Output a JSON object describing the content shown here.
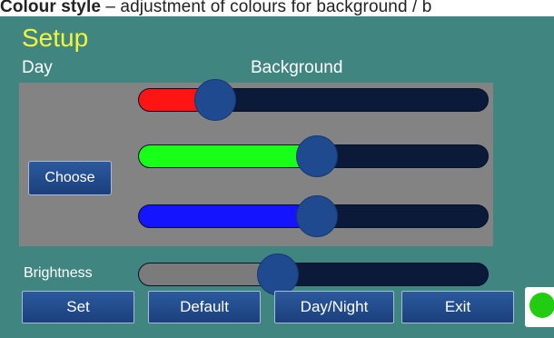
{
  "caption": {
    "bold": "Colour style",
    "rest": " – adjustment of colours for background / b"
  },
  "screen": {
    "title": "Setup",
    "mode_label": "Day",
    "section_label": "Background",
    "choose_label": "Choose",
    "brightness_label": "Brightness"
  },
  "sliders": [
    {
      "name": "red-slider",
      "color": "#ff1414",
      "value_pct": 22
    },
    {
      "name": "green-slider",
      "color": "#18ff18",
      "value_pct": 51
    },
    {
      "name": "blue-slider",
      "color": "#1414ff",
      "value_pct": 51
    },
    {
      "name": "brightness-slider",
      "color": "#7b7b7b",
      "value_pct": 40
    }
  ],
  "buttons": {
    "set": "Set",
    "default": "Default",
    "day_night": "Day/Night",
    "exit": "Exit"
  },
  "status": {
    "color": "#22cc11"
  }
}
